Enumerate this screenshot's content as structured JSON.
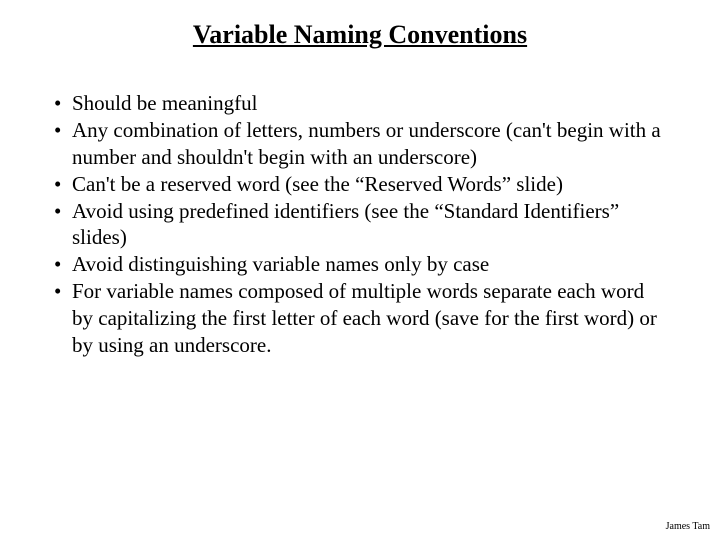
{
  "title": "Variable Naming Conventions",
  "bullets": {
    "b0": "Should be meaningful",
    "b1": "Any combination of letters, numbers or underscore (can't begin with a number and shouldn't begin with an underscore)",
    "b2": "Can't be a reserved word (see the “Reserved Words” slide)",
    "b3": "Avoid using predefined identifiers (see the “Standard Identifiers” slides)",
    "b4": "Avoid distinguishing variable names only by case",
    "b5": "For variable names composed of multiple words separate each word by capitalizing the first letter of each word (save for the first word) or by using an underscore."
  },
  "footer": "James Tam"
}
